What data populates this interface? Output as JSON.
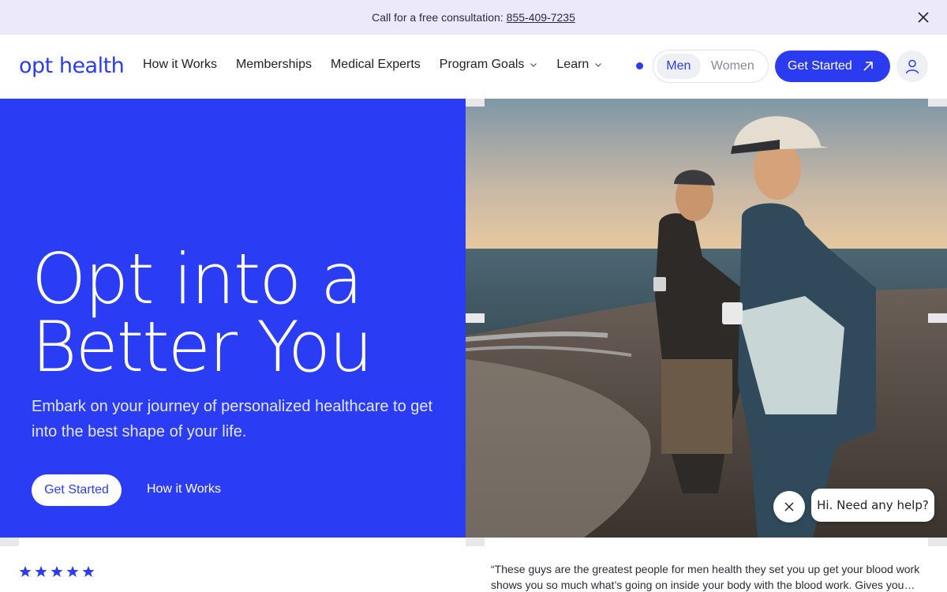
{
  "topbar": {
    "text": "Call for a free consultation:",
    "phone": "855-409-7235"
  },
  "header": {
    "logo": "opt health",
    "nav": [
      {
        "label": "How it Works",
        "has_dropdown": false
      },
      {
        "label": "Memberships",
        "has_dropdown": false
      },
      {
        "label": "Medical Experts",
        "has_dropdown": false
      },
      {
        "label": "Program Goals",
        "has_dropdown": true
      },
      {
        "label": "Learn",
        "has_dropdown": true
      }
    ],
    "gender_options": [
      "Men",
      "Women"
    ],
    "gender_selected": "Men",
    "cta": "Get Started"
  },
  "hero": {
    "title_line1": "Opt into a",
    "title_line2": "Better You",
    "subtitle": "Embark on your journey of personalized healthcare to get into the best shape of your life.",
    "primary_button": "Get Started",
    "secondary_button": "How it Works"
  },
  "chat": {
    "message": "Hi. Need any help?"
  },
  "testimonial": {
    "rating": 5,
    "quote": "“These guys are the greatest people for men health they set you up get your blood work shows you so much what’s going on inside your body with the blood work. Gives you…"
  },
  "colors": {
    "brand_blue": "#2b3cf0",
    "topbar_bg": "#ece9fb"
  }
}
